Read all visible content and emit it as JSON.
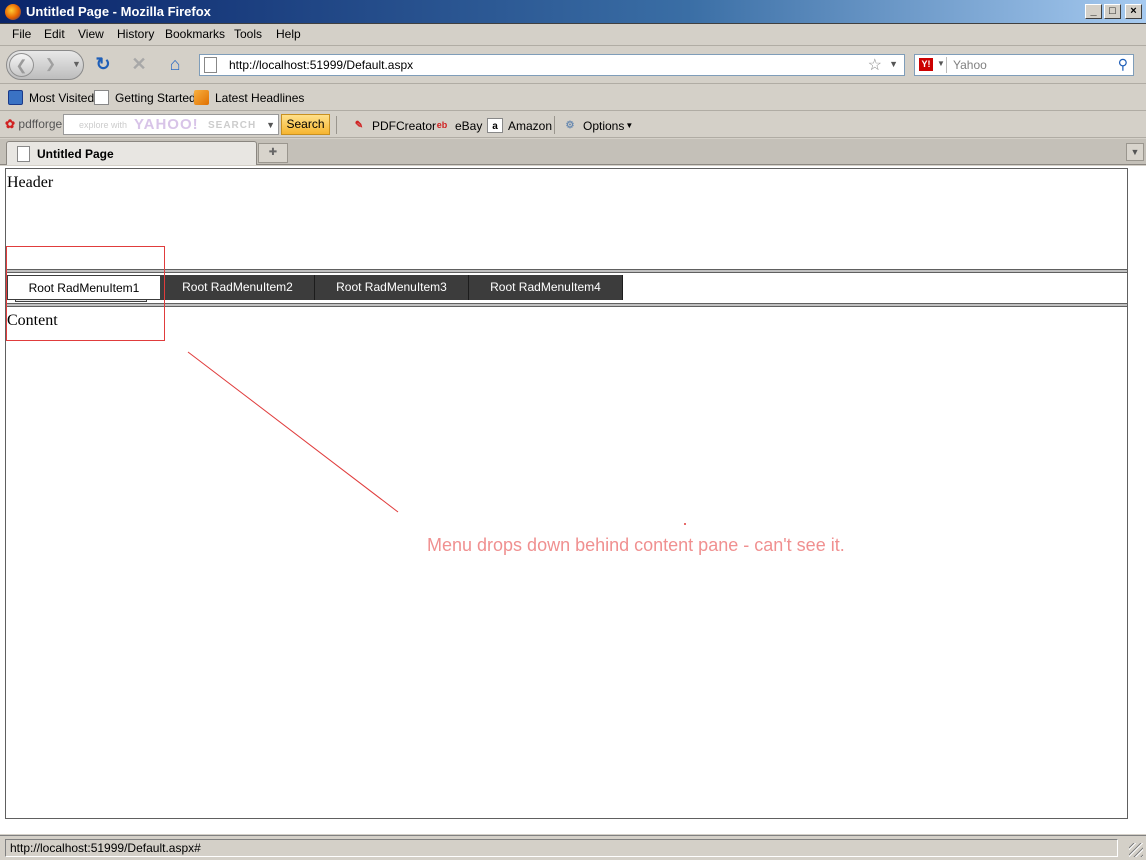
{
  "window": {
    "title": "Untitled Page - Mozilla Firefox",
    "minimize": "_",
    "maximize": "□",
    "close": "×"
  },
  "menubar": {
    "items": [
      {
        "label": "File"
      },
      {
        "label": "Edit"
      },
      {
        "label": "View"
      },
      {
        "label": "History"
      },
      {
        "label": "Bookmarks"
      },
      {
        "label": "Tools"
      },
      {
        "label": "Help"
      }
    ]
  },
  "nav": {
    "url": "http://localhost:51999/Default.aspx",
    "search_placeholder": "Yahoo",
    "search_engine_badge": "Y!"
  },
  "bookmarks": {
    "items": [
      {
        "label": "Most Visited"
      },
      {
        "label": "Getting Started"
      },
      {
        "label": "Latest Headlines"
      }
    ]
  },
  "pdfforge": {
    "logo": "pdfforge",
    "search_hint": "explore with",
    "search_brand": "YAHOO!",
    "search_word": "SEARCH",
    "search_button": "Search",
    "tools": [
      {
        "label": "PDFCreator",
        "icon": "pdf-icon"
      },
      {
        "label": "eBay",
        "icon": "ebay-icon"
      },
      {
        "label": "Amazon",
        "icon": "amazon-icon"
      },
      {
        "label": "Options",
        "icon": "gear-icon"
      }
    ]
  },
  "tabs": {
    "active": "Untitled Page"
  },
  "page": {
    "header_text": "Header",
    "content_text": "Content",
    "menu_items": [
      {
        "label": "Root RadMenuItem1"
      },
      {
        "label": "Root RadMenuItem2"
      },
      {
        "label": "Root RadMenuItem3"
      },
      {
        "label": "Root RadMenuItem4"
      }
    ]
  },
  "annotation": {
    "text": "Menu drops down behind content pane - can't see it.",
    "color": "#e03c3c"
  },
  "status": {
    "text": "http://localhost:51999/Default.aspx#"
  }
}
